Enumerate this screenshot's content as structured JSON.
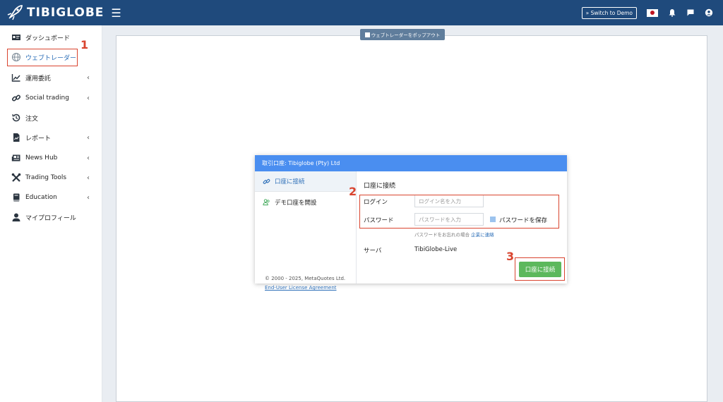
{
  "header": {
    "logo_text": "TIBIGLOBE",
    "switch_demo_label": "» Switch to Demo",
    "icons": [
      "menu-icon",
      "japan-flag-icon",
      "bell-icon",
      "chat-icon",
      "user-circle-icon"
    ]
  },
  "sidebar": {
    "items": [
      {
        "label": "ダッシュボード",
        "icon": "id-card-icon",
        "chevron": false
      },
      {
        "label": "ウェブトレーダー",
        "icon": "globe-icon",
        "chevron": false,
        "active": true
      },
      {
        "label": "運用委託",
        "icon": "chart-line-icon",
        "chevron": true
      },
      {
        "label": "Social trading",
        "icon": "link-icon",
        "chevron": true
      },
      {
        "label": "注文",
        "icon": "history-icon",
        "chevron": false
      },
      {
        "label": "レポート",
        "icon": "report-icon",
        "chevron": true
      },
      {
        "label": "News Hub",
        "icon": "newspaper-icon",
        "chevron": true
      },
      {
        "label": "Trading Tools",
        "icon": "tools-icon",
        "chevron": true
      },
      {
        "label": "Education",
        "icon": "book-icon",
        "chevron": true
      },
      {
        "label": "マイプロフィール",
        "icon": "user-icon",
        "chevron": false
      }
    ],
    "chevron": "‹"
  },
  "main": {
    "popout_label": "ウェブトレーダーをポップアウト"
  },
  "dialog": {
    "header": "取引口座: Tibiglobe (Pty) Ltd",
    "tabs": [
      {
        "label": "口座に接続",
        "icon": "link-icon"
      },
      {
        "label": "デモ口座を開設",
        "icon": "users-icon"
      }
    ],
    "copyright": "© 2000 - 2025, MetaQuotes Ltd.",
    "license": "End-User License Agreement",
    "title": "口座に接続",
    "login_label": "ログイン",
    "login_placeholder": "ログイン名を入力",
    "password_label": "パスワード",
    "password_placeholder": "パスワードを入力",
    "save_password": "パスワードを保存",
    "forgot_text": "パスワードをお忘れの場合",
    "forgot_link": "企業に連絡",
    "server_label": "サーバ",
    "server_value": "TibiGlobe-Live",
    "connect_button": "口座に接続"
  },
  "annotations": {
    "step1": "1",
    "step2": "2",
    "step3": "3"
  },
  "colors": {
    "header_bg": "#1f4a7c",
    "accent_blue": "#4a8ef0",
    "annotation_red": "#d9442f",
    "connect_green": "#5cb85c"
  }
}
